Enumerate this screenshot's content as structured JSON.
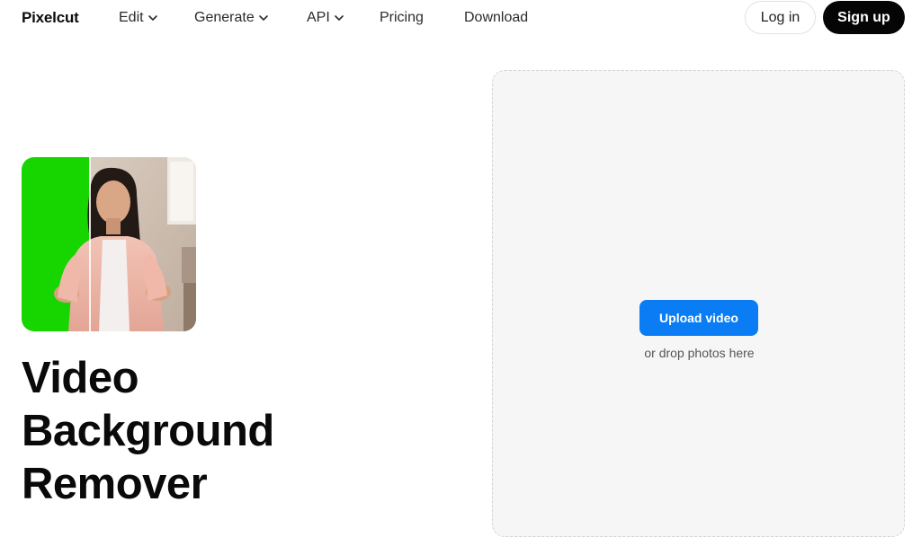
{
  "header": {
    "logo": "Pixelcut",
    "nav": [
      {
        "label": "Edit",
        "dropdown": true
      },
      {
        "label": "Generate",
        "dropdown": true
      },
      {
        "label": "API",
        "dropdown": true
      },
      {
        "label": "Pricing",
        "dropdown": false
      },
      {
        "label": "Download",
        "dropdown": false
      }
    ],
    "login_label": "Log in",
    "signup_label": "Sign up"
  },
  "hero": {
    "title_lines": [
      "Video",
      "Background",
      "Remover"
    ],
    "image_icon": "woman-green-screen-split-preview"
  },
  "upload": {
    "button_label": "Upload video",
    "drop_text": "or drop photos here"
  },
  "colors": {
    "accent": "#0a7df5",
    "signup_bg": "#050505",
    "panel_bg": "#f6f6f6",
    "green_screen": "#17d600"
  }
}
